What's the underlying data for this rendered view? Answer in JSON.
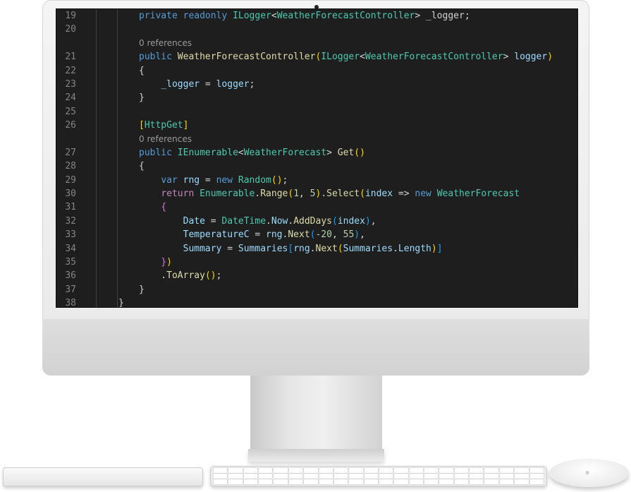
{
  "editor": {
    "lines": [
      {
        "n": "19",
        "segs": [
          [
            "kw",
            "private "
          ],
          [
            "kw",
            "readonly "
          ],
          [
            "ty",
            "ILogger"
          ],
          [
            "pn",
            "<"
          ],
          [
            "ty",
            "WeatherForecastController"
          ],
          [
            "pn",
            "> _logger;"
          ]
        ],
        "indent": 1
      },
      {
        "n": "20",
        "segs": [],
        "indent": 1
      },
      {
        "lens": "0 references"
      },
      {
        "n": "21",
        "segs": [
          [
            "kw",
            "public "
          ],
          [
            "fn",
            "WeatherForecastController"
          ],
          [
            "br",
            "("
          ],
          [
            "ty",
            "ILogger"
          ],
          [
            "pn",
            "<"
          ],
          [
            "ty",
            "WeatherForecastController"
          ],
          [
            "pn",
            "> "
          ],
          [
            "vr",
            "logger"
          ],
          [
            "br",
            ")"
          ]
        ],
        "indent": 1
      },
      {
        "n": "22",
        "segs": [
          [
            "pn",
            "{"
          ]
        ],
        "indent": 1
      },
      {
        "n": "23",
        "segs": [
          [
            "pn",
            "    "
          ],
          [
            "vr",
            "_logger"
          ],
          [
            "pn",
            " = "
          ],
          [
            "vr",
            "logger"
          ],
          [
            "pn",
            ";"
          ]
        ],
        "indent": 1
      },
      {
        "n": "24",
        "segs": [
          [
            "pn",
            "}"
          ]
        ],
        "indent": 1
      },
      {
        "n": "25",
        "segs": [],
        "indent": 1
      },
      {
        "n": "26",
        "segs": [
          [
            "br",
            "["
          ],
          [
            "ty",
            "HttpGet"
          ],
          [
            "br",
            "]"
          ]
        ],
        "indent": 1
      },
      {
        "lens": "0 references"
      },
      {
        "n": "27",
        "segs": [
          [
            "kw",
            "public "
          ],
          [
            "ty",
            "IEnumerable"
          ],
          [
            "pn",
            "<"
          ],
          [
            "ty",
            "WeatherForecast"
          ],
          [
            "pn",
            "> "
          ],
          [
            "fn",
            "Get"
          ],
          [
            "br",
            "()"
          ]
        ],
        "indent": 1
      },
      {
        "n": "28",
        "segs": [
          [
            "pn",
            "{"
          ]
        ],
        "indent": 1
      },
      {
        "n": "29",
        "segs": [
          [
            "pn",
            "    "
          ],
          [
            "kw",
            "var "
          ],
          [
            "vr",
            "rng"
          ],
          [
            "pn",
            " = "
          ],
          [
            "kw",
            "new "
          ],
          [
            "ty",
            "Random"
          ],
          [
            "br",
            "()"
          ],
          [
            "pn",
            ";"
          ]
        ],
        "indent": 1
      },
      {
        "n": "30",
        "segs": [
          [
            "pn",
            "    "
          ],
          [
            "ctl",
            "return "
          ],
          [
            "ty",
            "Enumerable"
          ],
          [
            "pn",
            "."
          ],
          [
            "fn",
            "Range"
          ],
          [
            "br",
            "("
          ],
          [
            "nm",
            "1"
          ],
          [
            "pn",
            ", "
          ],
          [
            "nm",
            "5"
          ],
          [
            "br",
            ")"
          ],
          [
            "pn",
            "."
          ],
          [
            "fn",
            "Select"
          ],
          [
            "br",
            "("
          ],
          [
            "vr",
            "index"
          ],
          [
            "pn",
            " => "
          ],
          [
            "kw",
            "new "
          ],
          [
            "ty",
            "WeatherForecast"
          ]
        ],
        "indent": 1
      },
      {
        "n": "31",
        "segs": [
          [
            "pn",
            "    "
          ],
          [
            "br2",
            "{"
          ]
        ],
        "indent": 1
      },
      {
        "n": "32",
        "segs": [
          [
            "pn",
            "        "
          ],
          [
            "vr",
            "Date"
          ],
          [
            "pn",
            " = "
          ],
          [
            "ty",
            "DateTime"
          ],
          [
            "pn",
            "."
          ],
          [
            "vr",
            "Now"
          ],
          [
            "pn",
            "."
          ],
          [
            "fn",
            "AddDays"
          ],
          [
            "br3",
            "("
          ],
          [
            "vr",
            "index"
          ],
          [
            "br3",
            ")"
          ],
          [
            "pn",
            ","
          ]
        ],
        "indent": 1
      },
      {
        "n": "33",
        "segs": [
          [
            "pn",
            "        "
          ],
          [
            "vr",
            "TemperatureC"
          ],
          [
            "pn",
            " = "
          ],
          [
            "vr",
            "rng"
          ],
          [
            "pn",
            "."
          ],
          [
            "fn",
            "Next"
          ],
          [
            "br3",
            "("
          ],
          [
            "nm",
            "-20"
          ],
          [
            "pn",
            ", "
          ],
          [
            "nm",
            "55"
          ],
          [
            "br3",
            ")"
          ],
          [
            "pn",
            ","
          ]
        ],
        "indent": 1
      },
      {
        "n": "34",
        "segs": [
          [
            "pn",
            "        "
          ],
          [
            "vr",
            "Summary"
          ],
          [
            "pn",
            " = "
          ],
          [
            "vr",
            "Summaries"
          ],
          [
            "br3",
            "["
          ],
          [
            "vr",
            "rng"
          ],
          [
            "pn",
            "."
          ],
          [
            "fn",
            "Next"
          ],
          [
            "br",
            "("
          ],
          [
            "vr",
            "Summaries"
          ],
          [
            "pn",
            "."
          ],
          [
            "vr",
            "Length"
          ],
          [
            "br",
            ")"
          ],
          [
            "br3",
            "]"
          ]
        ],
        "indent": 1
      },
      {
        "n": "35",
        "segs": [
          [
            "pn",
            "    "
          ],
          [
            "br2",
            "}"
          ],
          [
            "br",
            ")"
          ]
        ],
        "indent": 1
      },
      {
        "n": "36",
        "segs": [
          [
            "pn",
            "    ."
          ],
          [
            "fn",
            "ToArray"
          ],
          [
            "br",
            "()"
          ],
          [
            "pn",
            ";"
          ]
        ],
        "indent": 1
      },
      {
        "n": "37",
        "segs": [
          [
            "pn",
            "}"
          ]
        ],
        "indent": 1
      },
      {
        "n": "38",
        "segs": [],
        "indent": 0
      }
    ],
    "last_line_partial": "}"
  },
  "colors": {
    "background": "#1e1e1e",
    "keyword": "#569cd6",
    "type": "#4ec9b0",
    "function": "#dcdcaa",
    "variable": "#9cdcfe",
    "number": "#b5cea8",
    "line_number": "#858585"
  },
  "hardware": {
    "icons": [
      "camera-icon",
      "apple-logo-icon"
    ]
  }
}
